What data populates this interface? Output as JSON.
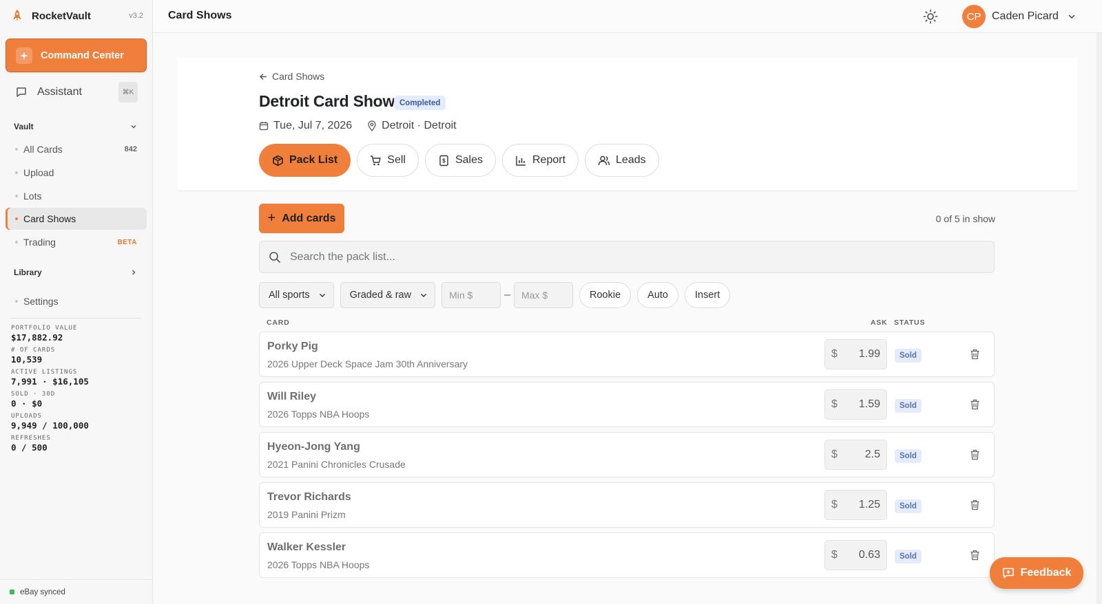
{
  "sidebar": {
    "brand_name": "RocketVault",
    "version": "v3.2",
    "command_center": "Command Center",
    "assistant": "Assistant",
    "assistant_shortcut": "⌘K",
    "sections": {
      "vault": "Vault",
      "library": "Library"
    },
    "items": [
      {
        "label": "All Cards",
        "trail": "842"
      },
      {
        "label": "Upload"
      },
      {
        "label": "Lots"
      },
      {
        "label": "Card Shows"
      },
      {
        "label": "Trading",
        "badge": "BETA"
      },
      {
        "label": "Settings"
      }
    ],
    "stats": [
      {
        "label": "PORTFOLIO VALUE",
        "value": "$17,882.92"
      },
      {
        "label": "# OF CARDS",
        "value": "10,539"
      },
      {
        "label": "ACTIVE LISTINGS",
        "value": "7,991 · $16,105"
      },
      {
        "label": "SOLD · 30D",
        "value": "0 · $0"
      },
      {
        "label": "UPLOADS",
        "value": "9,949 / 100,000"
      },
      {
        "label": "REFRESHES",
        "value": "0 / 500"
      }
    ],
    "sync_status": "eBay synced",
    "accent_color": "#f07f3c"
  },
  "topbar": {
    "title": "Card Shows",
    "user_initials": "CP",
    "user_name": "Caden Picard"
  },
  "show": {
    "back_label": "Card Shows",
    "title": "Detroit Card Show",
    "status": "Completed",
    "date": "Tue, Jul 7, 2026",
    "location": "Detroit · Detroit",
    "tabs": [
      "Pack List",
      "Sell",
      "Sales",
      "Report",
      "Leads"
    ]
  },
  "packlist": {
    "add_label": "Add cards",
    "count_text": "0 of 5 in show",
    "search_placeholder": "Search the pack list...",
    "filters": {
      "sport": "All sports",
      "grade": "Graded & raw",
      "min_placeholder": "Min $",
      "dash": "–",
      "max_placeholder": "Max $",
      "chips": [
        "Rookie",
        "Auto",
        "Insert"
      ]
    },
    "columns": {
      "card": "CARD",
      "ask": "ASK",
      "status": "STATUS"
    },
    "currency": "$",
    "rows": [
      {
        "name": "Porky Pig",
        "set": "2026 Upper Deck Space Jam 30th Anniversary",
        "ask": "1.99",
        "status": "Sold"
      },
      {
        "name": "Will Riley",
        "set": "2026 Topps NBA Hoops",
        "ask": "1.59",
        "status": "Sold"
      },
      {
        "name": "Hyeon-Jong Yang",
        "set": "2021 Panini Chronicles Crusade",
        "ask": "2.5",
        "status": "Sold"
      },
      {
        "name": "Trevor Richards",
        "set": "2019 Panini Prizm",
        "ask": "1.25",
        "status": "Sold"
      },
      {
        "name": "Walker Kessler",
        "set": "2026 Topps NBA Hoops",
        "ask": "0.63",
        "status": "Sold"
      }
    ]
  },
  "feedback_label": "Feedback"
}
